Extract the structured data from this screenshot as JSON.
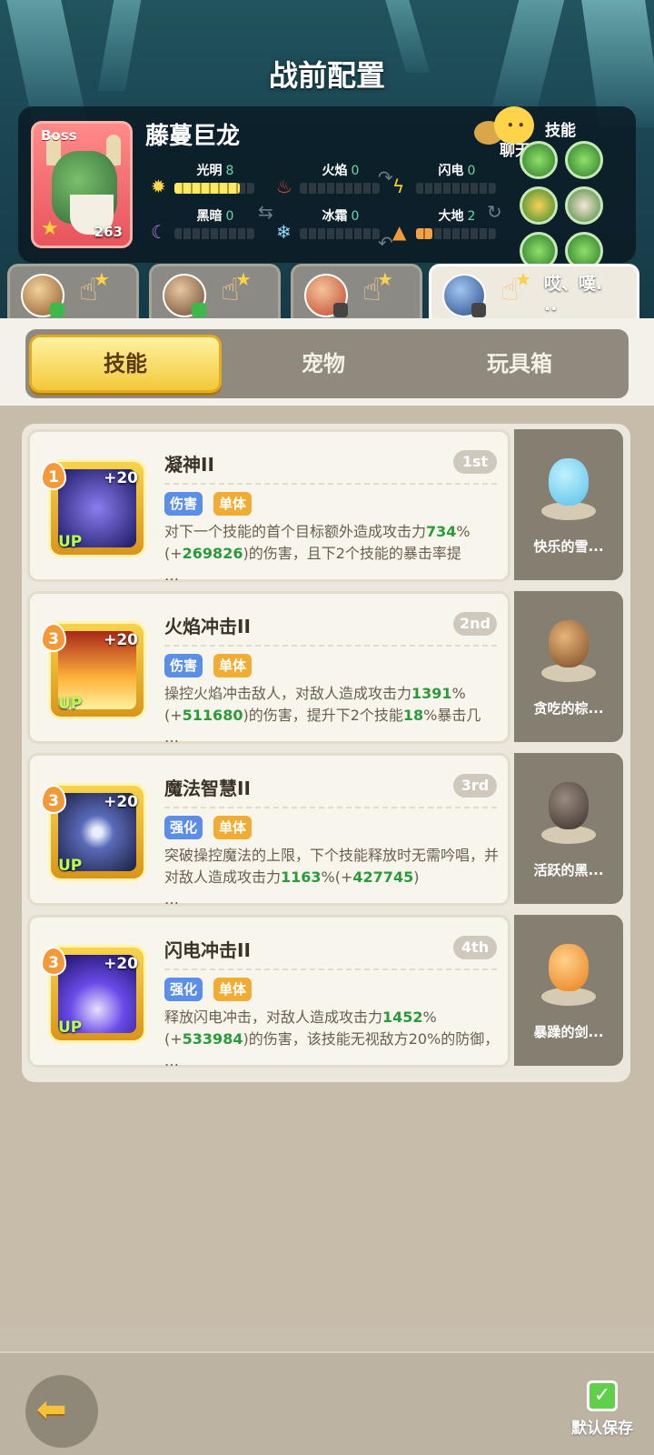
{
  "header": {
    "title": "战前配置"
  },
  "boss": {
    "tag": "Boss",
    "name": "藤蔓巨龙",
    "level": "263",
    "elements": [
      {
        "label": "光明",
        "value": "8"
      },
      {
        "label": "火焰",
        "value": "0"
      },
      {
        "label": "闪电",
        "value": "0"
      },
      {
        "label": "黑暗",
        "value": "0"
      },
      {
        "label": "冰霜",
        "value": "0"
      },
      {
        "label": "大地",
        "value": "2"
      }
    ],
    "skills_label": "技能",
    "chat_label": "聊天"
  },
  "team_tabs": [
    {
      "text": ""
    },
    {
      "text": ""
    },
    {
      "text": ""
    },
    {
      "text": "哎、嘆.\n.."
    }
  ],
  "main_tabs": [
    {
      "label": "技能"
    },
    {
      "label": "宠物"
    },
    {
      "label": "玩具箱"
    }
  ],
  "skills": [
    {
      "name": "凝神II",
      "rank": "1st",
      "level": "1",
      "plus": "+20",
      "up": "UP",
      "tags": [
        "伤害",
        "单体"
      ],
      "desc_parts": [
        "对下一个技能的首个目标额外造成攻击力",
        "734",
        "%(+",
        "269826",
        ")的伤害，且下2个技能的暴击率提",
        "\n…"
      ],
      "pet_name": "快乐的雪..."
    },
    {
      "name": "火焰冲击II",
      "rank": "2nd",
      "level": "3",
      "plus": "+20",
      "up": "UP",
      "tags": [
        "伤害",
        "单体"
      ],
      "desc_parts": [
        "操控火焰冲击敌人，对敌人造成攻击力",
        "1391",
        "%(+",
        "511680",
        ")的伤害，提升下2个技能",
        "18",
        "%暴击几",
        "\n…"
      ],
      "pet_name": "贪吃的棕..."
    },
    {
      "name": "魔法智慧II",
      "rank": "3rd",
      "level": "3",
      "plus": "+20",
      "up": "UP",
      "tags": [
        "强化",
        "单体"
      ],
      "desc_parts": [
        "突破操控魔法的上限，下个技能释放时无需吟唱，并对敌人造成攻击力",
        "1163",
        "%(+",
        "427745",
        ")",
        "\n…"
      ],
      "pet_name": "活跃的黑..."
    },
    {
      "name": "闪电冲击II",
      "rank": "4th",
      "level": "3",
      "plus": "+20",
      "up": "UP",
      "tags": [
        "强化",
        "单体"
      ],
      "desc_parts": [
        "释放闪电冲击，对敌人造成攻击力",
        "1452",
        "%(+",
        "533984",
        ")的伤害，该技能无视敌方20%的防御，",
        "\n…"
      ],
      "pet_name": "暴躁的剑..."
    }
  ],
  "bottom": {
    "save_label": "默认保存"
  }
}
